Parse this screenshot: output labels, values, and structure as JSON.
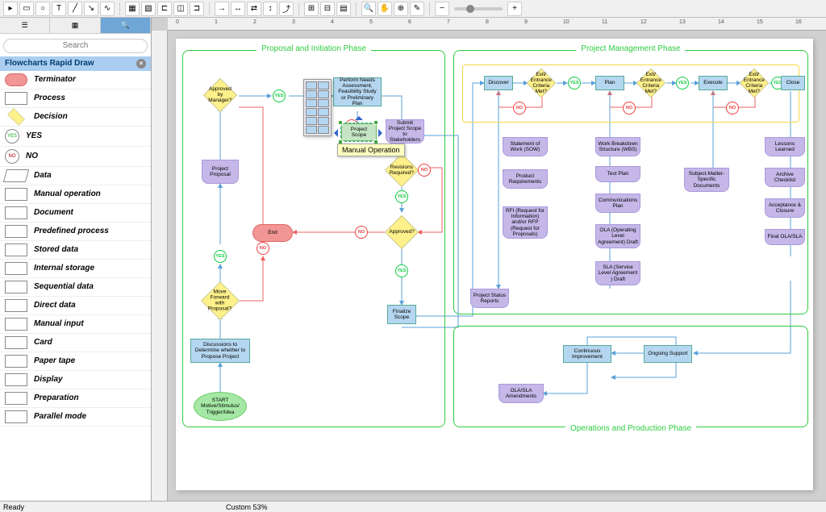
{
  "toolbar": {
    "zoom_label": "Zoom"
  },
  "sidebar": {
    "search_placeholder": "Search",
    "library_title": "Flowcharts Rapid Draw",
    "shapes": [
      "Terminator",
      "Process",
      "Decision",
      "YES",
      "NO",
      "Data",
      "Manual operation",
      "Document",
      "Predefined process",
      "Stored data",
      "Internal storage",
      "Sequential data",
      "Direct data",
      "Manual input",
      "Card",
      "Paper tape",
      "Display",
      "Preparation",
      "Parallel mode"
    ]
  },
  "phases": {
    "proposal": "Proposal and Initiation Phase",
    "management": "Project Management Phase",
    "operations": "Operations and Production Phase"
  },
  "nodes": {
    "start": "START Motive/Stimulus/ Trigger/Idea",
    "discuss": "Discussions to Determine whether to Propose Project",
    "moveforward": "Move Forward with Proposal?",
    "projprop": "Project Proposal",
    "appmgr": "Approved by Manager?",
    "end": "End",
    "needs": "Perform Needs Assessment, Feasibility Study or Preliminary Plan",
    "scope": "Project Scope",
    "submit": "Submit Project Scope to Stakeholders",
    "revisions": "Revisions Required?",
    "approved": "Approved?",
    "finalize": "Finalize Scope",
    "manualop_tooltip": "Manual Operation",
    "discover": "Discover",
    "plan": "Plan",
    "execute": "Execute",
    "close": "Close",
    "exit1": "Exit/ Entrance Criteria Met?",
    "exit2": "Exit/ Entrance Criteria Met?",
    "exit3": "Exit/ Entrance Criteria Met?",
    "sow": "Statement of Work (SOW)",
    "prodreq": "Product Requirements",
    "rfi": "RFI (Request for Information) and/or RFP (Request for Proposals)",
    "psr": "Project Status Reports",
    "wbs": "Work Breakdown Structure (WBS)",
    "testplan": "Test Plan",
    "commplan": "Communications Plan",
    "ola": "OLA (Operating Level Agreement) Draft",
    "sla": "SLA (Service Level Agreement ) Draft",
    "sme": "Subject-Matter-Specific Documents",
    "lessons": "Lessons Learned",
    "archive": "Archive Checklist",
    "accept": "Acceptance & Closure",
    "finalola": "Final OLA/SLA",
    "ci": "Continuous Improvement",
    "ongoing": "Ongoing Support",
    "amend": "OLA/SLA Amendments",
    "yes": "YES",
    "no": "NO"
  },
  "ruler_ticks": [
    "0",
    "1",
    "2",
    "3",
    "4",
    "5",
    "6",
    "7",
    "8",
    "9",
    "10",
    "11",
    "12",
    "13",
    "14",
    "15",
    "16"
  ],
  "statusbar": {
    "ready": "Ready",
    "zoom": "Custom 53%"
  }
}
